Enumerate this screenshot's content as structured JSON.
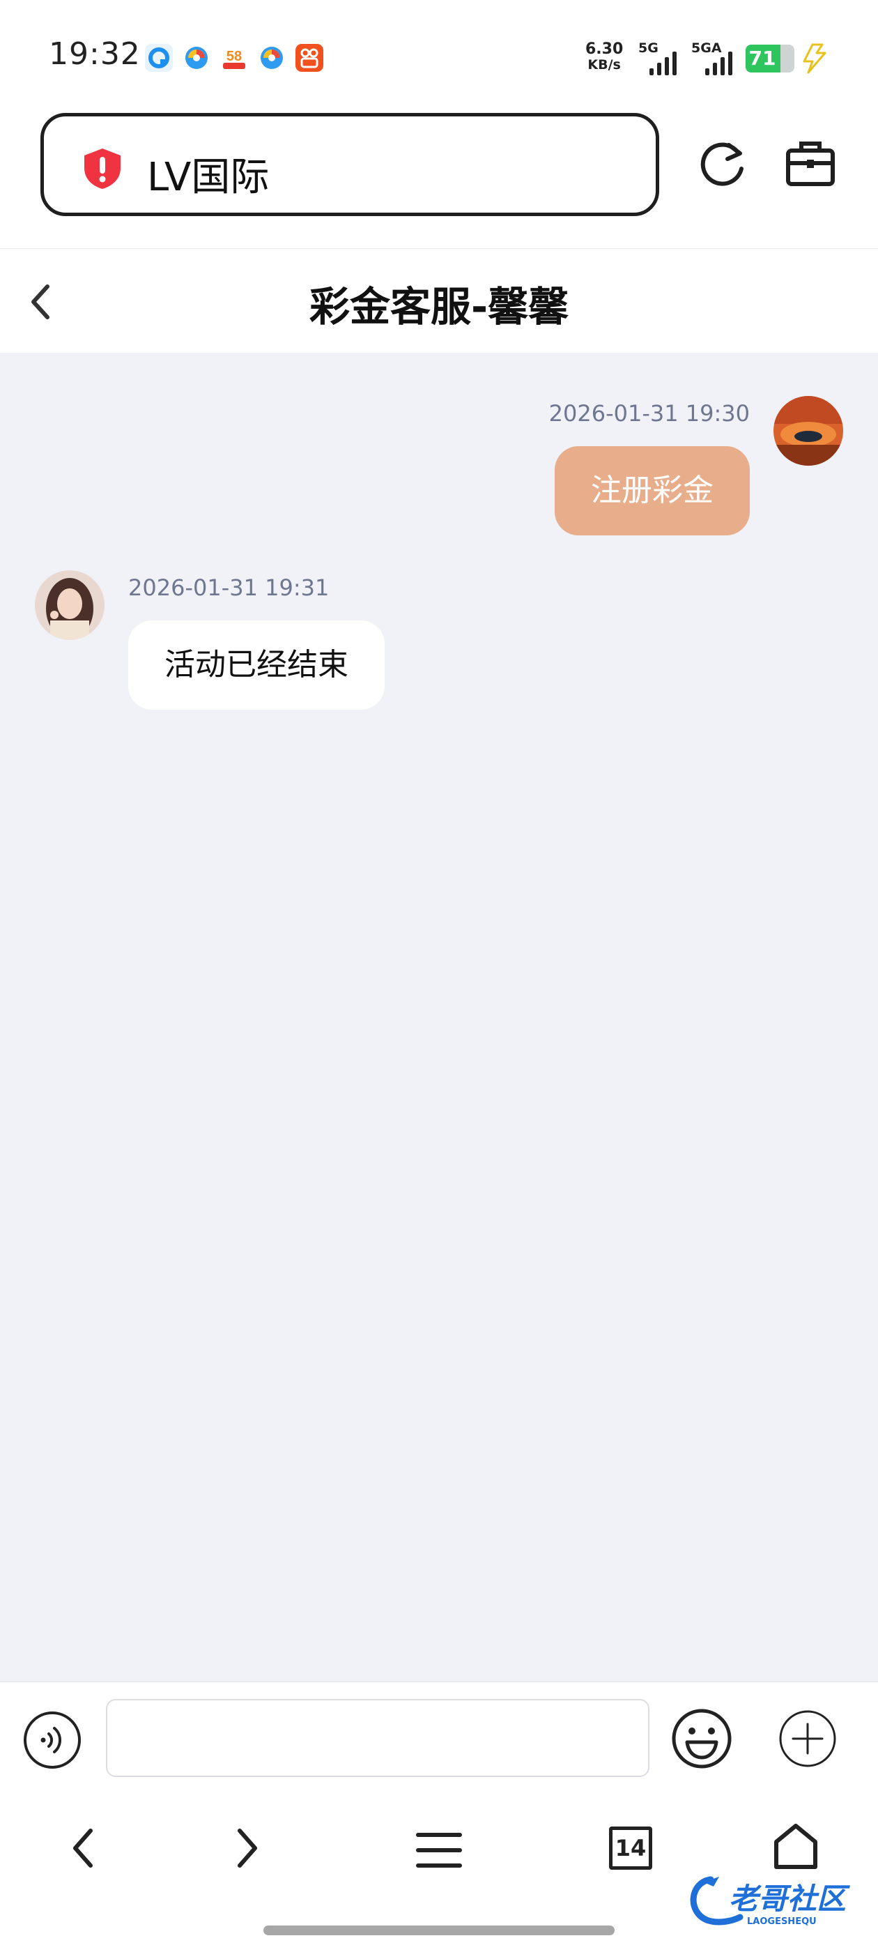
{
  "status_bar": {
    "time": "19:32",
    "net_speed_value": "6.30",
    "net_speed_unit": "KB/s",
    "signal_1_label": "5G",
    "signal_2_label": "5GA",
    "battery_level": "71",
    "battery_fraction": 0.71,
    "app_icons": [
      "browser-app-icon",
      "map-app-icon",
      "58-app-icon",
      "map-app-icon-2",
      "kuaishou-app-icon"
    ]
  },
  "browser": {
    "address_text": "LV国际",
    "tab_count": "14"
  },
  "chat": {
    "title": "彩金客服-馨馨",
    "messages": [
      {
        "side": "right",
        "time": "2026-01-31 19:30",
        "text": "注册彩金"
      },
      {
        "side": "left",
        "time": "2026-01-31 19:31",
        "text": "活动已经结束"
      }
    ]
  },
  "input": {
    "placeholder": ""
  },
  "watermark": {
    "text": "老哥社区",
    "subtext": "LAOGESHEQU"
  },
  "colors": {
    "bubble_mine": "#e8ad8a",
    "chat_background": "#f1f2f8",
    "shield_red": "#ef3340",
    "battery_green": "#2ec55e"
  }
}
